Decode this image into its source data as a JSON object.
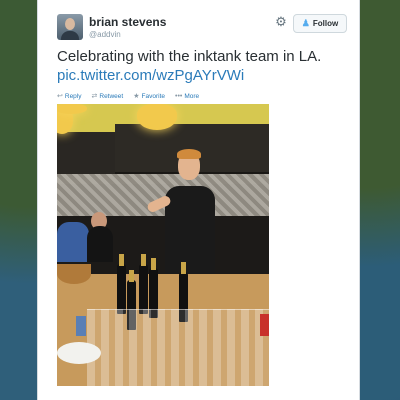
{
  "user": {
    "display_name": "brian stevens",
    "handle": "@addvin",
    "avatar": "avatar"
  },
  "header": {
    "settings_icon": "gear-icon",
    "follow_label": "Follow",
    "follow_icon": "follow-user-icon"
  },
  "tweet": {
    "text": "Celebrating with the inktank team in LA.",
    "link": "pic.twitter.com/wzPgAYrVWi"
  },
  "actions": [
    {
      "label": "Reply",
      "icon": "reply-icon"
    },
    {
      "label": "Retweet",
      "icon": "retweet-icon"
    },
    {
      "label": "Favorite",
      "icon": "star-icon"
    },
    {
      "label": "More",
      "icon": "more-icon"
    }
  ],
  "colors": {
    "link": "#2b7bb9",
    "text": "#292f33",
    "muted": "#8899a6"
  }
}
